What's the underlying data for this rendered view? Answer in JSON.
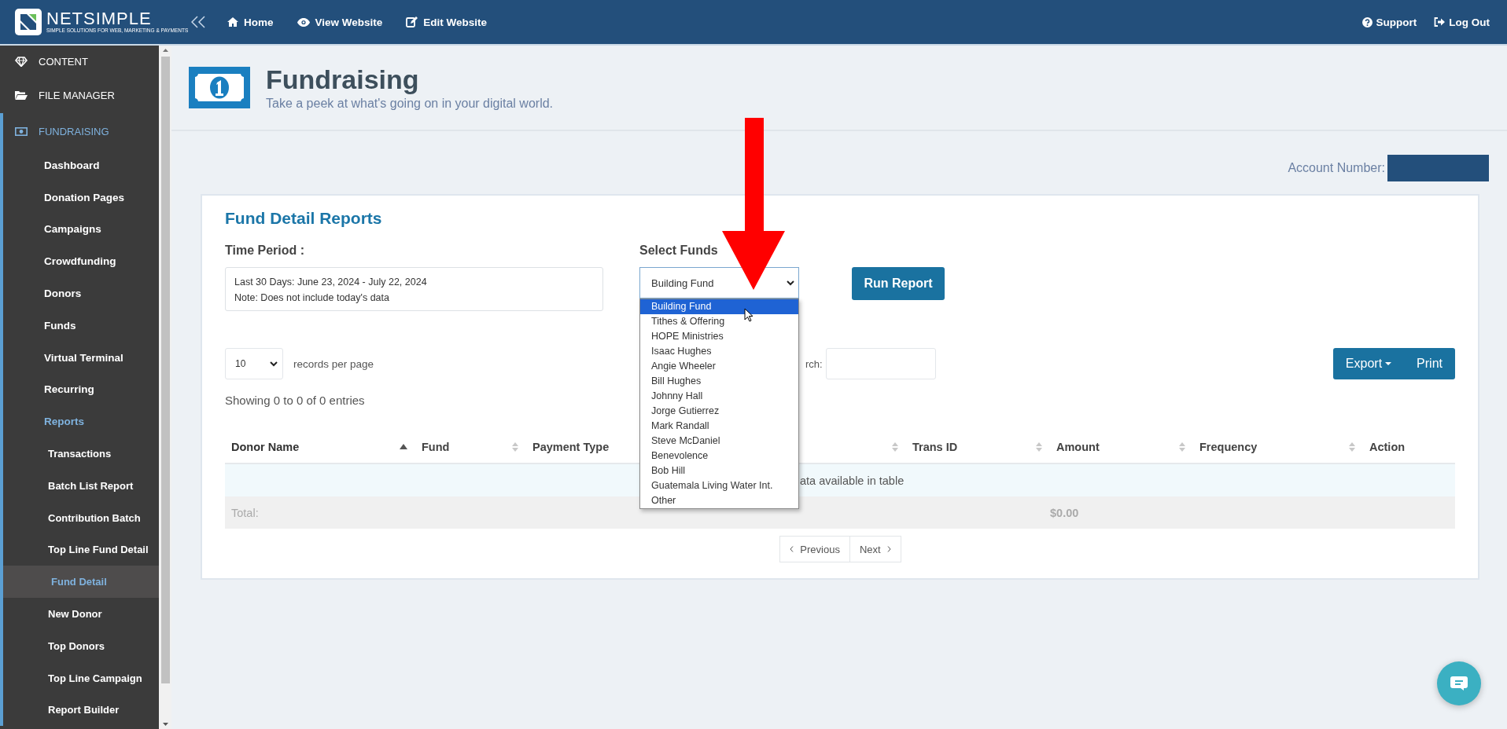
{
  "topbar": {
    "logo": {
      "name": "NETSIMPLE",
      "tagline": "SIMPLE SOLUTIONS FOR WEB, MARKETING & PAYMENTS"
    },
    "nav": [
      {
        "label": "Home",
        "kind": "home"
      },
      {
        "label": "View Website",
        "kind": "view"
      },
      {
        "label": "Edit Website",
        "kind": "edit"
      }
    ],
    "right": [
      {
        "label": "Support",
        "kind": "support"
      },
      {
        "label": "Log Out",
        "kind": "logout"
      }
    ]
  },
  "sidebar": {
    "sections": [
      {
        "label": "CONTENT",
        "kind": "content",
        "expanded": false
      },
      {
        "label": "FILE MANAGER",
        "kind": "files",
        "expanded": false
      },
      {
        "label": "FUNDRAISING",
        "kind": "fundraising",
        "expanded": true,
        "children": [
          {
            "label": "Dashboard",
            "expanded": false
          },
          {
            "label": "Donation Pages",
            "expanded": false
          },
          {
            "label": "Campaigns",
            "expanded": false
          },
          {
            "label": "Crowdfunding",
            "expanded": false
          },
          {
            "label": "Donors",
            "expanded": false
          },
          {
            "label": "Funds",
            "expanded": false
          },
          {
            "label": "Virtual Terminal",
            "expanded": false
          },
          {
            "label": "Recurring",
            "expanded": false
          },
          {
            "label": "Reports",
            "expanded": true,
            "children": [
              {
                "label": "Transactions",
                "selected": false
              },
              {
                "label": "Batch List Report",
                "selected": false
              },
              {
                "label": "Contribution Batch",
                "selected": false
              },
              {
                "label": "Top Line Fund Detail",
                "selected": false
              },
              {
                "label": "Fund Detail",
                "selected": true
              },
              {
                "label": "New Donor",
                "selected": false
              },
              {
                "label": "Top Donors",
                "selected": false
              },
              {
                "label": "Top Line Campaign",
                "selected": false
              },
              {
                "label": "Report Builder",
                "selected": false
              }
            ]
          }
        ]
      }
    ]
  },
  "header": {
    "title": "Fundraising",
    "subtitle": "Take a peek at what's going on in your digital world."
  },
  "account": {
    "label": "Account Number:"
  },
  "report": {
    "title": "Fund Detail Reports",
    "time_period": {
      "label": "Time Period :",
      "lines": [
        "Last 30 Days: June 23, 2024 - July 22, 2024",
        "Note: Does not include today's data"
      ]
    },
    "select_funds": {
      "label": "Select Funds",
      "value": "Building Fund",
      "expanded": true,
      "options": [
        {
          "label": "Building Fund",
          "selected": true
        },
        {
          "label": "Tithes & Offering",
          "selected": false
        },
        {
          "label": "HOPE Ministries",
          "selected": false
        },
        {
          "label": "Isaac Hughes",
          "selected": false
        },
        {
          "label": "Angie Wheeler",
          "selected": false
        },
        {
          "label": "Bill Hughes",
          "selected": false
        },
        {
          "label": "Johnny Hall",
          "selected": false
        },
        {
          "label": "Jorge Gutierrez",
          "selected": false
        },
        {
          "label": "Mark Randall",
          "selected": false
        },
        {
          "label": "Steve McDaniel",
          "selected": false
        },
        {
          "label": "Benevolence",
          "selected": false
        },
        {
          "label": "Bob Hill",
          "selected": false
        },
        {
          "label": "Guatemala Living Water Int.",
          "selected": false
        },
        {
          "label": "Other",
          "selected": false
        }
      ]
    },
    "run_button": "Run Report",
    "page_size": {
      "value": "10",
      "suffix": "records per page"
    },
    "search": {
      "label": "rch:"
    },
    "export_buttons": [
      {
        "label": "Export",
        "kind": "dropdown"
      },
      {
        "label": "Print",
        "kind": "plain"
      }
    ],
    "info": "Showing 0 to 0 of 0 entries",
    "table": {
      "columns": [
        {
          "label": "Donor Name",
          "sortable": true,
          "sorted": true
        },
        {
          "label": "Fund",
          "sortable": true,
          "sorted": false
        },
        {
          "label": "Payment Type",
          "sortable": true,
          "sorted": false
        },
        {
          "label": "Trans ID",
          "sortable": true,
          "sorted": false
        },
        {
          "label": "Amount",
          "sortable": true,
          "sorted": false
        },
        {
          "label": "Frequency",
          "sortable": true,
          "sorted": false
        },
        {
          "label": "Action",
          "sortable": false
        }
      ],
      "empty_text": "ata available in table",
      "total_label": "Total:",
      "total_amount": "$0.00"
    },
    "pagination": [
      {
        "label": "Previous",
        "kind": "prev"
      },
      {
        "label": "Next",
        "kind": "next"
      }
    ]
  }
}
